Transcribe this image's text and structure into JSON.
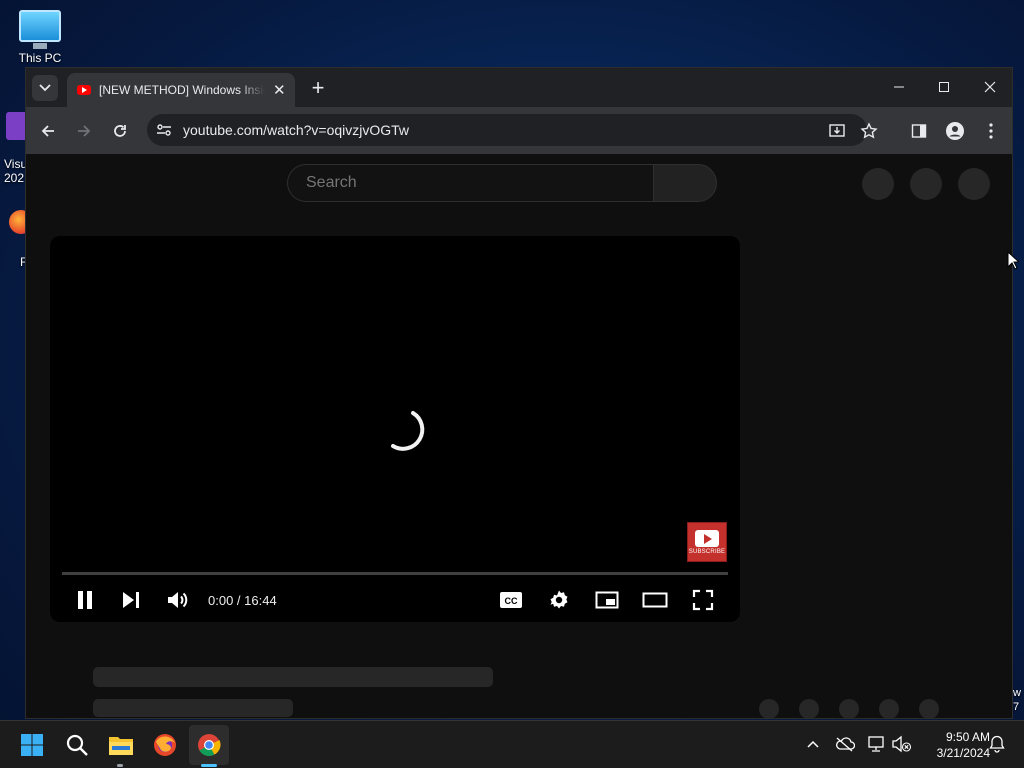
{
  "desktop": {
    "icons": [
      {
        "label": "This PC"
      },
      {
        "label": "Visu\n202"
      },
      {
        "label": "F"
      }
    ],
    "right_edge_text": "w\n7"
  },
  "browser": {
    "active_tab": {
      "title": "[NEW METHOD] Windows Insid",
      "close": "✕"
    },
    "new_tab": "+",
    "address": "youtube.com/watch?v=oqivzjvOGTw"
  },
  "youtube": {
    "search_placeholder": "Search",
    "player": {
      "time": "0:00 / 16:44",
      "subscribe_badge": "SUBSCRIBE",
      "progress_fraction": 0.0
    }
  },
  "taskbar": {
    "clock_time": "9:50 AM",
    "clock_date": "3/21/2024"
  },
  "colors": {
    "yt_red": "#ff0000",
    "chrome_dark": "#202124",
    "toolbar": "#35363a"
  }
}
